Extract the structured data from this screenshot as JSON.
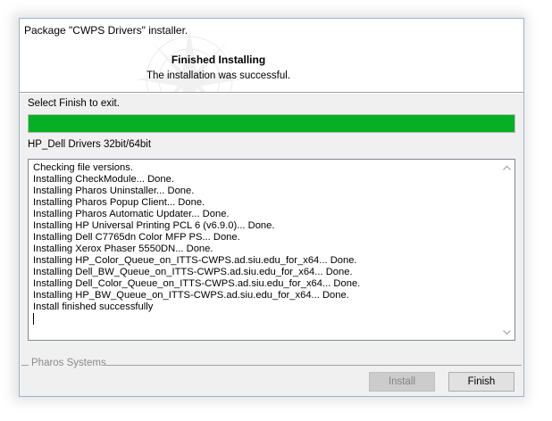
{
  "window": {
    "title": "Package \"CWPS Drivers\" installer."
  },
  "header": {
    "heading": "Finished Installing",
    "subheading": "The installation was successful."
  },
  "status": {
    "instruction": "Select Finish to exit.",
    "progress_percent": 100,
    "progress_color": "#06b025",
    "package_name": "HP_Dell Drivers 32bit/64bit"
  },
  "log": {
    "lines": [
      "Checking file versions.",
      "Installing CheckModule... Done.",
      "Installing Pharos Uninstaller... Done.",
      "Installing Pharos Popup Client... Done.",
      "Installing Pharos Automatic Updater... Done.",
      "Installing HP Universal Printing PCL 6 (v6.9.0)... Done.",
      "Installing Dell C7765dn Color MFP PS... Done.",
      "Installing Xerox Phaser 5550DN... Done.",
      "Installing HP_Color_Queue_on_ITTS-CWPS.ad.siu.edu_for_x64... Done.",
      "Installing Dell_BW_Queue_on_ITTS-CWPS.ad.siu.edu_for_x64... Done.",
      "Installing Dell_Color_Queue_on_ITTS-CWPS.ad.siu.edu_for_x64... Done.",
      "Installing HP_BW_Queue_on_ITTS-CWPS.ad.siu.edu_for_x64... Done.",
      "Install finished successfully"
    ]
  },
  "footer": {
    "brand": "Pharos Systems",
    "install_label": "Install",
    "finish_label": "Finish"
  },
  "icons": {
    "scroll_up": "chevron-up-icon",
    "scroll_down": "chevron-down-icon"
  }
}
